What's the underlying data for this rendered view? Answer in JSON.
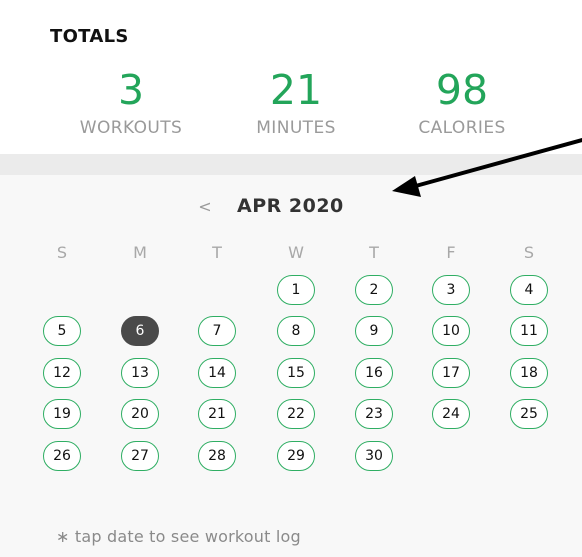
{
  "totals": {
    "title": "TOTALS",
    "stats": [
      {
        "value": "3",
        "label": "WORKOUTS"
      },
      {
        "value": "21",
        "label": "MINUTES"
      },
      {
        "value": "98",
        "label": "CALORIES"
      }
    ]
  },
  "calendar": {
    "prev_icon": "<",
    "month_label": "APR 2020",
    "weekdays": [
      "S",
      "M",
      "T",
      "W",
      "T",
      "F",
      "S"
    ],
    "days": [
      "1",
      "2",
      "3",
      "4",
      "5",
      "6",
      "7",
      "8",
      "9",
      "10",
      "11",
      "12",
      "13",
      "14",
      "15",
      "16",
      "17",
      "18",
      "19",
      "20",
      "21",
      "22",
      "23",
      "24",
      "25",
      "26",
      "27",
      "28",
      "29",
      "30"
    ],
    "selected_day": "6",
    "footnote": "∗ tap date to see workout log"
  },
  "colors": {
    "accent_green": "#23a55a",
    "selected_day_fill": "#4a4a4a"
  },
  "icons": {
    "prev": "chevron-left-icon",
    "annotation": "arrow-icon"
  }
}
